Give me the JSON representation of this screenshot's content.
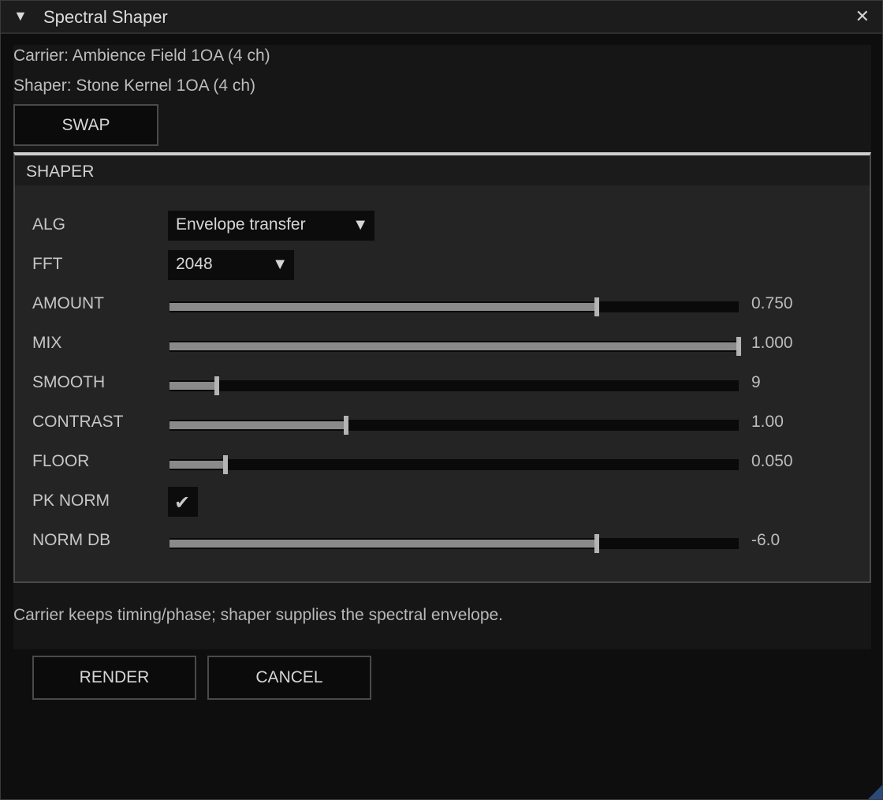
{
  "window": {
    "title": "Spectral Shaper",
    "collapse_glyph": "▼",
    "close_glyph": "✕"
  },
  "info": {
    "carrier": "Carrier: Ambience Field 1OA  (4 ch)",
    "shaper": "Shaper: Stone Kernel 1OA  (4 ch)"
  },
  "swap_label": "SWAP",
  "shaper_group": {
    "title": "SHAPER",
    "alg": {
      "label": "ALG",
      "value": "Envelope transfer"
    },
    "fft": {
      "label": "FFT",
      "value": "2048"
    },
    "sliders": [
      {
        "key": "amount",
        "label": "AMOUNT",
        "value": "0.750",
        "fraction": 0.75
      },
      {
        "key": "mix",
        "label": "MIX",
        "value": "1.000",
        "fraction": 1.0
      },
      {
        "key": "smooth",
        "label": "SMOOTH",
        "value": "9",
        "fraction": 0.083
      },
      {
        "key": "contrast",
        "label": "CONTRAST",
        "value": "1.00",
        "fraction": 0.31
      },
      {
        "key": "floor",
        "label": "FLOOR",
        "value": "0.050",
        "fraction": 0.098
      }
    ],
    "pk_norm": {
      "label": "PK NORM",
      "checked": true
    },
    "norm_db": {
      "label": "NORM DB",
      "value": "-6.0",
      "fraction": 0.75
    }
  },
  "hint": "Carrier keeps timing/phase; shaper supplies the spectral envelope.",
  "buttons": {
    "render": "RENDER",
    "cancel": "CANCEL"
  },
  "colors": {
    "background": "#0e0e0e",
    "panel": "#242424",
    "slider_fill": "#8a8a8a",
    "accent_grip": "#2a4a7a"
  },
  "icons": {
    "collapse": "triangle-down-icon",
    "close": "close-icon",
    "dropdown": "chevron-down-icon",
    "check": "checkmark-icon"
  }
}
